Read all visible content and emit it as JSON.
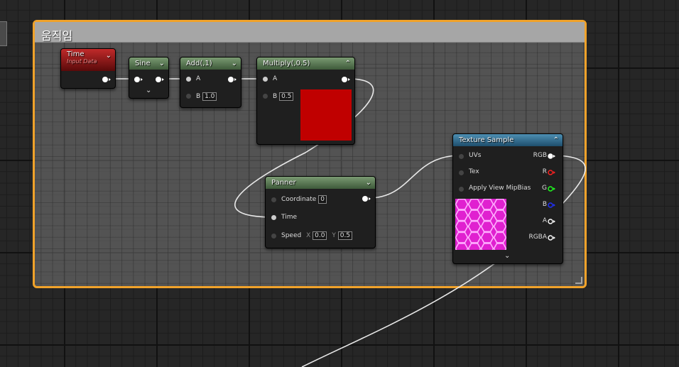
{
  "comment_box": {
    "title": "움직임"
  },
  "nodes": {
    "time": {
      "title": "Time",
      "subtitle": "Input Data"
    },
    "sine": {
      "title": "Sine"
    },
    "add": {
      "title": "Add(,1)",
      "a_label": "A",
      "b_label": "B",
      "b_value": "1.0"
    },
    "multiply": {
      "title": "Multiply(,0.5)",
      "a_label": "A",
      "b_label": "B",
      "b_value": "0.5",
      "preview_color": "#c00000"
    },
    "panner": {
      "title": "Panner",
      "coordinate_label": "Coordinate",
      "coordinate_value": "0",
      "time_label": "Time",
      "speed_label": "Speed",
      "x_label": "X",
      "x_value": "0.0",
      "y_label": "Y",
      "y_value": "0.5"
    },
    "texture_sample": {
      "title": "Texture Sample",
      "inputs": [
        "UVs",
        "Tex",
        "Apply View MipBias"
      ],
      "outputs": [
        "RGB",
        "R",
        "G",
        "B",
        "A",
        "RGBA"
      ],
      "output_colors": [
        "#ffffff",
        "#ff2020",
        "#20ff20",
        "#2030ff",
        "#ffffff",
        "#ffffff"
      ],
      "preview_color": "#e020d0"
    }
  },
  "icons": {
    "collapse": "chevron-up-icon",
    "expand": "chevron-down-icon"
  }
}
